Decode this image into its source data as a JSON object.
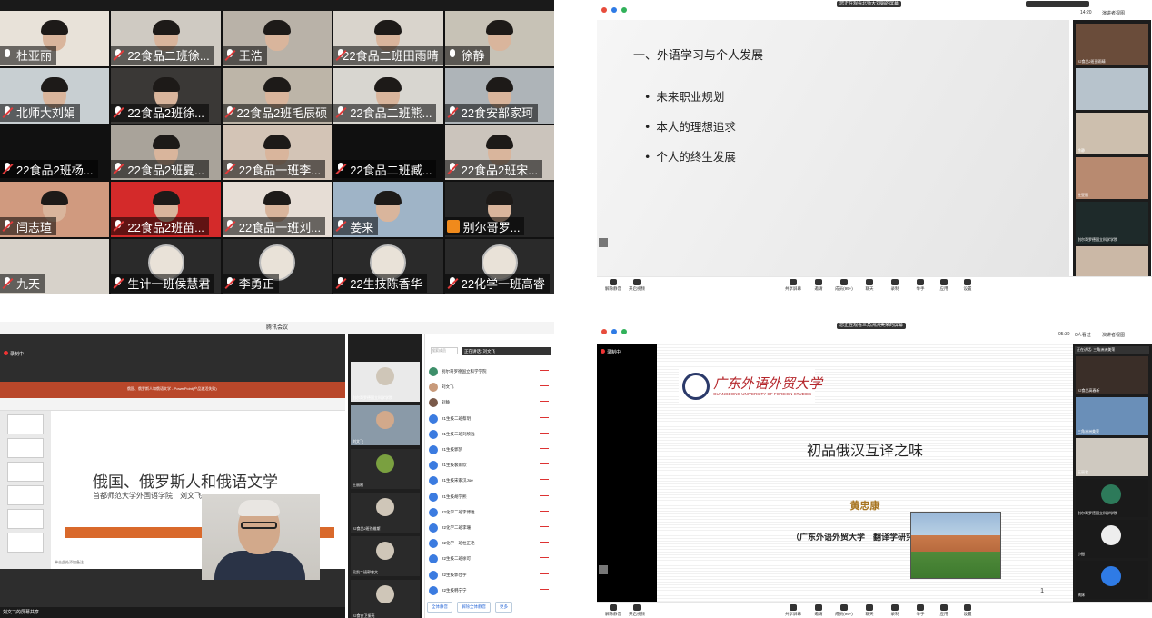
{
  "panel1": {
    "tiles": [
      {
        "name": "杜亚丽",
        "mic": "on",
        "bg": "#e8e2d9"
      },
      {
        "name": "22食品二班徐...",
        "mic": "muted",
        "bg": "#cfcac2"
      },
      {
        "name": "王浩",
        "mic": "muted",
        "bg": "#b9b2a8"
      },
      {
        "name": "22食品二班田雨晴",
        "mic": "muted",
        "bg": "#d9d4cc"
      },
      {
        "name": "徐静",
        "mic": "on",
        "bg": "#c7c2b6"
      },
      {
        "name": "北师大刘娟",
        "mic": "muted",
        "bg": "#c8cfd2"
      },
      {
        "name": "22食品2班徐...",
        "mic": "muted",
        "bg": "#3a3836"
      },
      {
        "name": "22食品2班毛辰硕",
        "mic": "muted",
        "bg": "#bdb5a8"
      },
      {
        "name": "22食品二班熊...",
        "mic": "muted",
        "bg": "#d8d6d0"
      },
      {
        "name": "22食安部家珂",
        "mic": "muted",
        "bg": "#aeb4b8"
      },
      {
        "name": "22食品2班杨...",
        "mic": "muted",
        "bg": "#111111"
      },
      {
        "name": "22食品2班夏...",
        "mic": "muted",
        "bg": "#a9a39a"
      },
      {
        "name": "22食品一班李...",
        "mic": "muted",
        "bg": "#d3c4b6"
      },
      {
        "name": "22食品二班臧...",
        "mic": "muted",
        "bg": "#101010"
      },
      {
        "name": "22食品2班宋...",
        "mic": "muted",
        "bg": "#cbc4bc"
      },
      {
        "name": "闫志瑄",
        "mic": "muted",
        "bg": "#d09a7f"
      },
      {
        "name": "22食品2班苗...",
        "mic": "muted",
        "bg": "#d42a2a"
      },
      {
        "name": "22食品一班刘...",
        "mic": "muted",
        "bg": "#e6ddd5"
      },
      {
        "name": "姜来",
        "mic": "muted",
        "bg": "#9fb4c7"
      },
      {
        "name": "别尔哥罗...",
        "mic": "phone",
        "bg": "#262626"
      },
      {
        "name": "九天",
        "mic": "muted",
        "bg": "#d7d2ca"
      },
      {
        "name": "生计一班侯慧君",
        "mic": "muted",
        "bg": "#2a2a2a"
      },
      {
        "name": "李勇正",
        "mic": "muted",
        "bg": "#2a2a2a"
      },
      {
        "name": "22生技陈香华",
        "mic": "muted",
        "bg": "#2a2a2a"
      },
      {
        "name": "22化学一班高睿",
        "mic": "muted",
        "bg": "#2a2a2a"
      }
    ]
  },
  "panel2": {
    "meeting_pill": "您正在观看北师大刘娟的屏幕",
    "time": "14:20",
    "view_label": "演讲者视图",
    "slide": {
      "heading": "一、外语学习与个人发展",
      "bullets": [
        "未来职业规划",
        "本人的理想追求",
        "个人的终生发展"
      ]
    },
    "side_names": [
      "22食品2班田雨晴",
      "",
      "徐静",
      "杜亚丽",
      "别尔哥罗德国立科学学院",
      ""
    ],
    "toolbar": [
      "解除静音",
      "开启视频",
      "共享屏幕",
      "邀请",
      "成员(99+)",
      "聊天",
      "录制",
      "举手",
      "应用",
      "设置"
    ]
  },
  "panel3": {
    "window_title": "腾讯会议",
    "recording": "录制中",
    "ppt_title_bar": "俄国、俄罗斯人和俄语文学 - PowerPoint(产品激活失败)",
    "slide_title": "俄国、俄罗斯人和俄语文学",
    "slide_subtitle": "首都师范大学外国语学院　刘文飞",
    "notes_hint": "单击此处添加备注",
    "share_bar": "刘文飞的屏幕共享",
    "search_placeholder": "搜索成员",
    "speaking": "正在讲话: 刘文飞",
    "video_names": [
      "别尔哥罗德国立科学学院",
      "刘文飞",
      "王丽雅",
      "22食品2班徐维斯",
      "吴凯二班郭睿文",
      "22食安卫振亮"
    ],
    "participants": [
      "别尔哥罗德国立科学学院",
      "刘文飞",
      "刘静",
      "21生技二班蔡玥",
      "21生技二班刘欣远",
      "21生技郭凯",
      "21生技裴雨欣",
      "21生技宋家汉Joe",
      "21生技胡学熙",
      "22化学二班李博雅",
      "22化学二班李珊",
      "22化学一班杜正艳",
      "22生技二班徐可",
      "22生技郭佳宇",
      "22生技韩宁宁"
    ],
    "buttons": [
      "全体静音",
      "解除全体静音",
      "更多"
    ]
  },
  "panel4": {
    "meeting_pill": "您正在观看三角洲洲美荣的屏幕",
    "time": "05:30",
    "count": "0人看过",
    "view_label": "演讲者视图",
    "recording": "录制中",
    "speaking": "正在讲话: 三角洲洲美荣",
    "slide": {
      "logo_cn": "广东外语外贸大学",
      "logo_en": "GUANGDONG UNIVERSITY OF FOREIGN STUDIES",
      "title": "初品俄汉互译之味",
      "author": "黄忠康",
      "org": "（广东外语外贸大学　翻译学研究中心）",
      "page": "1"
    },
    "side_names": [
      "22食品高春新",
      "三角洲洲美荣",
      "王丽君",
      "别尔哥罗德国立科学学院",
      "小甜",
      "刷床"
    ],
    "toolbar": [
      "解除静音",
      "开启视频",
      "共享屏幕",
      "邀请",
      "成员(99+)",
      "聊天",
      "录制",
      "举手",
      "应用",
      "设置"
    ]
  }
}
